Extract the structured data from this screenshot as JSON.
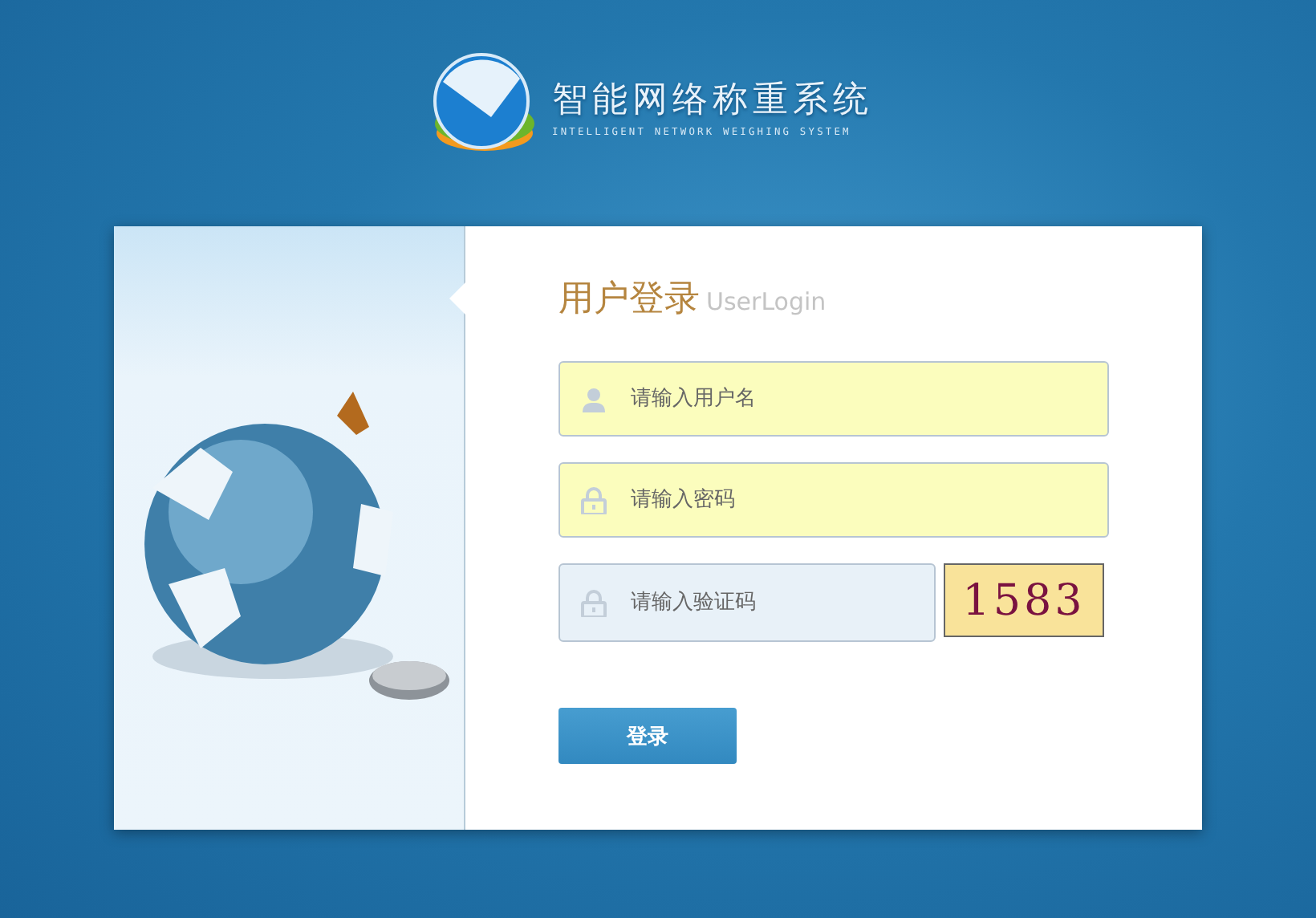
{
  "header": {
    "title": "智能网络称重系统",
    "subtitle": "INTELLIGENT NETWORK WEIGHING SYSTEM"
  },
  "login": {
    "title": "用户登录",
    "title_en": "UserLogin",
    "fields": [
      {
        "kind": "user",
        "placeholder": "请输入用户名"
      },
      {
        "kind": "password",
        "placeholder": "请输入密码"
      },
      {
        "kind": "captcha",
        "placeholder": "请输入验证码"
      }
    ],
    "captcha": "1583",
    "submit": "登录"
  }
}
